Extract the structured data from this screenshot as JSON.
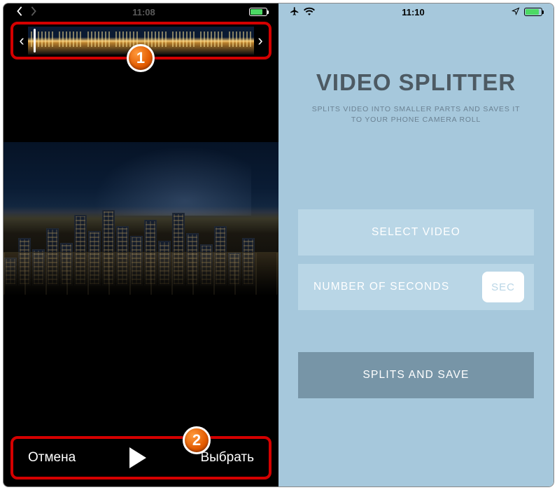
{
  "left": {
    "status": {
      "time": "11:08"
    },
    "trimmer": {
      "left_handle": "‹",
      "right_handle": "›"
    },
    "callouts": {
      "one": "1",
      "two": "2"
    },
    "bottom": {
      "cancel": "Отмена",
      "select": "Выбрать"
    }
  },
  "right": {
    "status": {
      "time": "11:10"
    },
    "title": "VIDEO SPLITTER",
    "subtitle": "SPLITS VIDEO INTO SMALLER PARTS AND SAVES IT TO YOUR PHONE CAMERA ROLL",
    "buttons": {
      "select_video": "SELECT VIDEO",
      "seconds_label": "NUMBER OF SECONDS",
      "seconds_placeholder": "SEC",
      "split_save": "SPLITS AND SAVE"
    }
  },
  "colors": {
    "highlight": "#d40000",
    "accent_bg": "#a6c8dc"
  }
}
